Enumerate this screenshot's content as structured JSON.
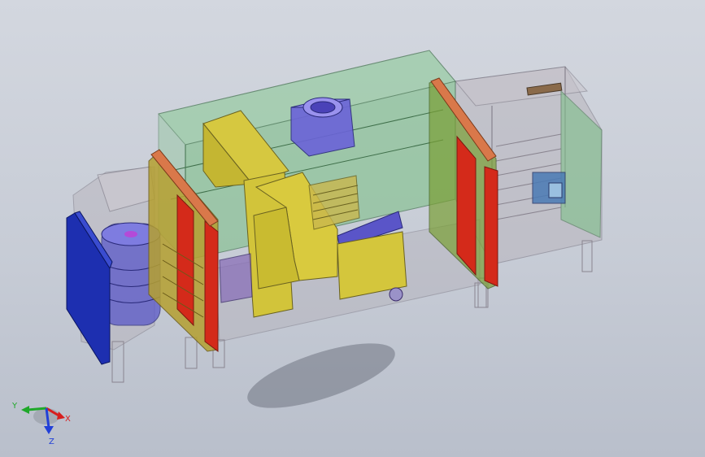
{
  "viewport": {
    "background_top": "#d3d7df",
    "background_bottom": "#b9bfcb"
  },
  "model": {
    "panel_blue": "#1d2fb0",
    "panel_red": "#d42a1a",
    "panel_orange": "#d9784a",
    "enclosure_green": "#7fc08a",
    "gantry_yellow": "#d6c840",
    "spindle_purple": "#6b63d8",
    "frame_grey": "#9a9a9a"
  },
  "triad": {
    "x_label": "X",
    "y_label": "Y",
    "z_label": "Z",
    "x_color": "#d81e1e",
    "y_color": "#1fa82a",
    "z_color": "#2240d8"
  }
}
